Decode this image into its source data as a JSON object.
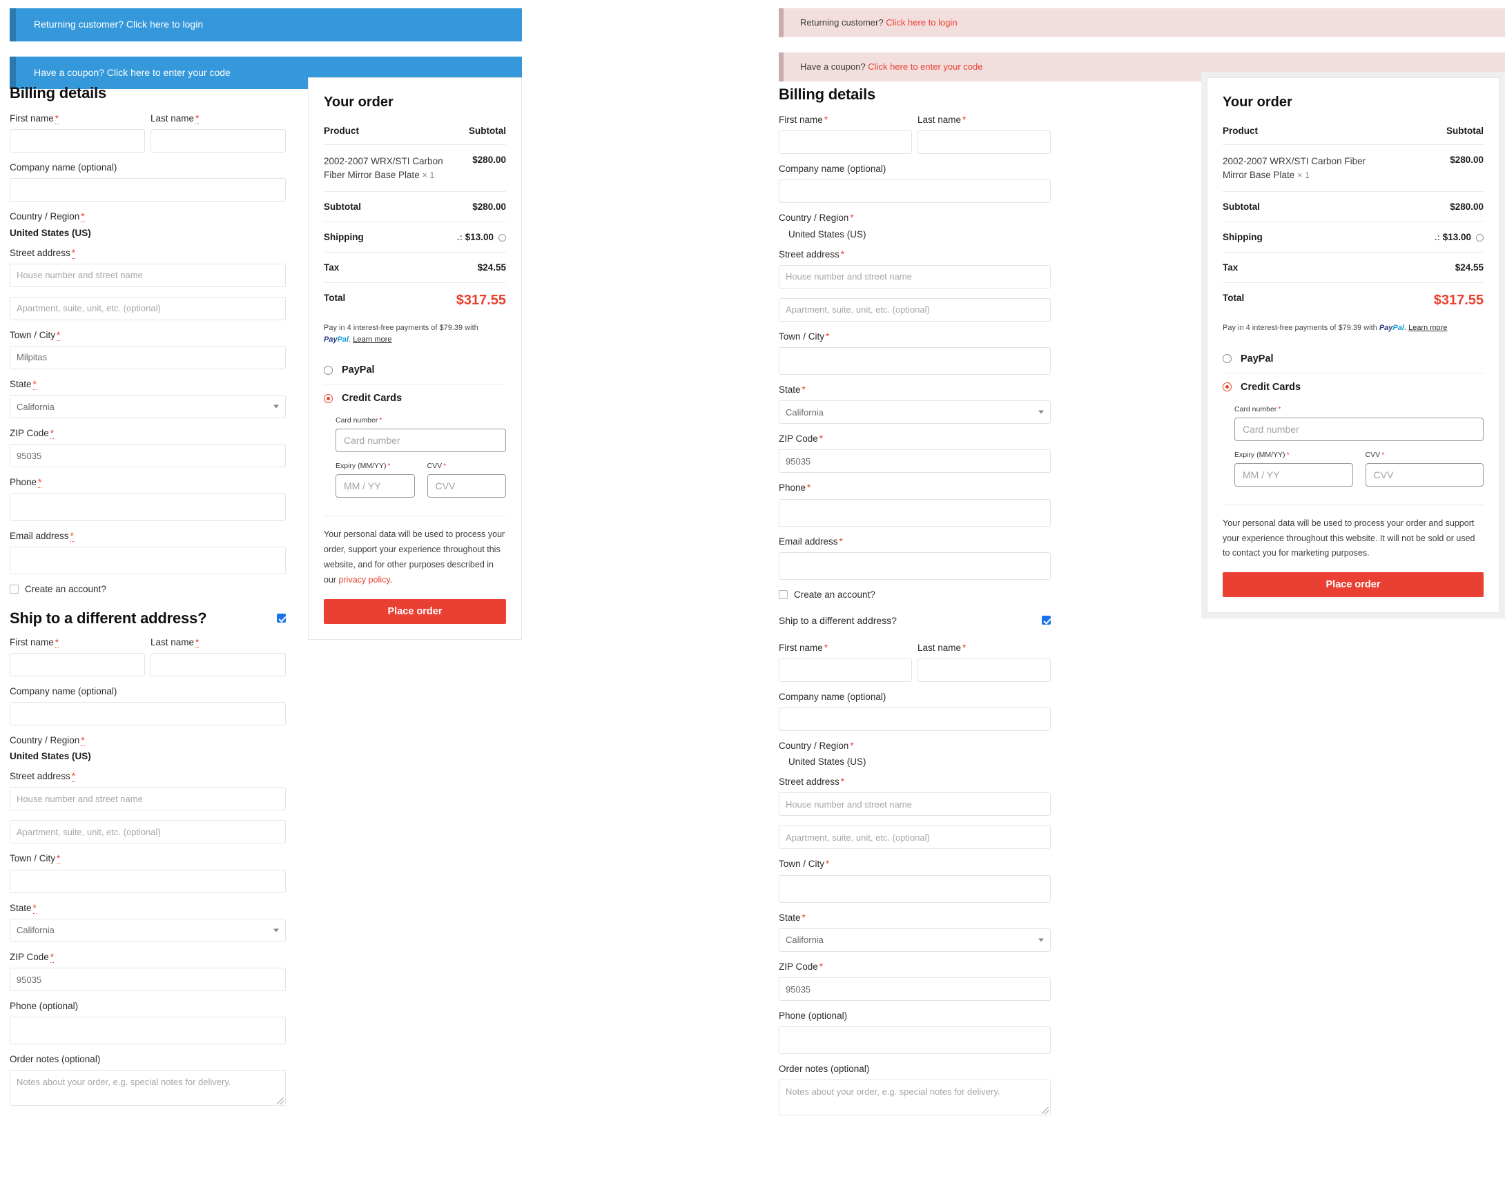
{
  "variants": [
    {
      "id": "blue",
      "notices": [
        {
          "prefix": "Returning customer? ",
          "link": "Click here to login"
        },
        {
          "prefix": "Have a coupon? ",
          "link": "Click here to enter your code"
        }
      ],
      "billing": {
        "heading": "Billing details",
        "first_name_label": "First name",
        "first_name_value": "",
        "last_name_label": "Last name",
        "last_name_value": "",
        "company_label": "Company name (optional)",
        "company_value": "",
        "country_label": "Country / Region",
        "country_value": "United States (US)",
        "street_label": "Street address",
        "street_placeholder": "House number and street name",
        "apt_placeholder": "Apartment, suite, unit, etc. (optional)",
        "city_label": "Town / City",
        "city_value": "Milpitas",
        "state_label": "State",
        "state_value": "California",
        "zip_label": "ZIP Code",
        "zip_value": "95035",
        "phone_label": "Phone",
        "phone_value": "",
        "email_label": "Email address",
        "email_value": "",
        "create_account_label": "Create an account?"
      },
      "shipping": {
        "heading": "Ship to a different address?",
        "checked": true,
        "first_name_label": "First name",
        "last_name_label": "Last name",
        "company_label": "Company name (optional)",
        "country_label": "Country / Region",
        "country_value": "United States (US)",
        "street_label": "Street address",
        "street_placeholder": "House number and street name",
        "apt_placeholder": "Apartment, suite, unit, etc. (optional)",
        "city_label": "Town / City",
        "city_value": "",
        "state_label": "State",
        "state_value": "California",
        "zip_label": "ZIP Code",
        "zip_value": "95035",
        "phone_label": "Phone (optional)",
        "notes_label": "Order notes (optional)",
        "notes_placeholder": "Notes about your order, e.g. special notes for delivery."
      },
      "order": {
        "title": "Your order",
        "col_product": "Product",
        "col_subtotal": "Subtotal",
        "item_name": "2002-2007 WRX/STI Carbon Fiber Mirror Base Plate",
        "item_qty": "× 1",
        "item_price": "$280.00",
        "subtotal_label": "Subtotal",
        "subtotal_value": "$280.00",
        "shipping_label": "Shipping",
        "shipping_prefix": ".:",
        "shipping_value": "$13.00",
        "tax_label": "Tax",
        "tax_value": "$24.55",
        "total_label": "Total",
        "total_value": "$317.55",
        "paypal_note_pre": "Pay in 4 interest-free payments of $79.39 with ",
        "paypal_brand_a": "Pay",
        "paypal_brand_b": "Pal",
        "paypal_note_post": ". ",
        "paypal_learn_more": "Learn more",
        "pay_paypal": "PayPal",
        "pay_credit": "Credit Cards",
        "card_number_label": "Card number",
        "card_number_placeholder": "Card number",
        "expiry_label": "Expiry (MM/YY)",
        "expiry_placeholder": "MM / YY",
        "cvv_label": "CVV",
        "cvv_placeholder": "CVV",
        "privacy_text": "Your personal data will be used to process your order, support your experience throughout this website, and for other purposes described in our ",
        "privacy_link": "privacy policy",
        "privacy_tail": ".",
        "place_order": "Place order"
      }
    },
    {
      "id": "pink",
      "notices": [
        {
          "prefix": "Returning customer? ",
          "link": "Click here to login"
        },
        {
          "prefix": "Have a coupon? ",
          "link": "Click here to enter your code"
        }
      ],
      "billing": {
        "heading": "Billing details",
        "first_name_label": "First name",
        "first_name_value": "",
        "last_name_label": "Last name",
        "last_name_value": "",
        "company_label": "Company name (optional)",
        "company_value": "",
        "country_label": "Country / Region",
        "country_value": "United States (US)",
        "street_label": "Street address",
        "street_placeholder": "House number and street name",
        "apt_placeholder": "Apartment, suite, unit, etc. (optional)",
        "city_label": "Town / City",
        "city_value": "",
        "state_label": "State",
        "state_value": "California",
        "zip_label": "ZIP Code",
        "zip_value": "95035",
        "phone_label": "Phone",
        "phone_value": "",
        "email_label": "Email address",
        "email_value": "",
        "create_account_label": "Create an account?"
      },
      "shipping": {
        "heading": "Ship to a different address?",
        "checked": true,
        "first_name_label": "First name",
        "last_name_label": "Last name",
        "company_label": "Company name (optional)",
        "country_label": "Country / Region",
        "country_value": "United States (US)",
        "street_label": "Street address",
        "street_placeholder": "House number and street name",
        "apt_placeholder": "Apartment, suite, unit, etc. (optional)",
        "city_label": "Town / City",
        "city_value": "",
        "state_label": "State",
        "state_value": "California",
        "zip_label": "ZIP Code",
        "zip_value": "95035",
        "phone_label": "Phone (optional)",
        "notes_label": "Order notes (optional)",
        "notes_placeholder": "Notes about your order, e.g. special notes for delivery."
      },
      "order": {
        "title": "Your order",
        "col_product": "Product",
        "col_subtotal": "Subtotal",
        "item_name": "2002-2007 WRX/STI Carbon Fiber Mirror Base Plate",
        "item_qty": "× 1",
        "item_price": "$280.00",
        "subtotal_label": "Subtotal",
        "subtotal_value": "$280.00",
        "shipping_label": "Shipping",
        "shipping_prefix": ".:",
        "shipping_value": "$13.00",
        "tax_label": "Tax",
        "tax_value": "$24.55",
        "total_label": "Total",
        "total_value": "$317.55",
        "paypal_note_pre": "Pay in 4 interest-free payments of $79.39 with ",
        "paypal_brand_a": "Pay",
        "paypal_brand_b": "Pal",
        "paypal_note_post": ". ",
        "paypal_learn_more": "Learn more",
        "pay_paypal": "PayPal",
        "pay_credit": "Credit Cards",
        "card_number_label": "Card number",
        "card_number_placeholder": "Card number",
        "expiry_label": "Expiry (MM/YY)",
        "expiry_placeholder": "MM / YY",
        "cvv_label": "CVV",
        "cvv_placeholder": "CVV",
        "privacy_text": "Your personal data will be used to process your order and support your experience throughout this website. It will not be sold or used to contact you for marketing purposes.",
        "privacy_link": "",
        "privacy_tail": "",
        "place_order": "Place order"
      }
    }
  ],
  "colors": {
    "notice_blue": "#3498db",
    "notice_blue_border": "#2a7ab1",
    "notice_pink": "#f3dede",
    "notice_pink_border": "#c9adad",
    "accent_red": "#e8412f",
    "button_red": "#ea3f33",
    "checkbox_blue": "#1a73e8"
  }
}
